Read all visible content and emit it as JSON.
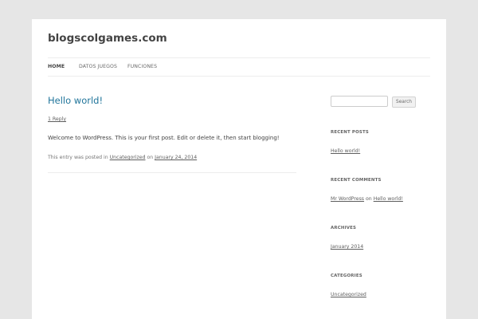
{
  "site": {
    "title": "blogscolgames.com"
  },
  "nav": {
    "items": [
      "Home",
      "Datos Juegos",
      "Funciones"
    ]
  },
  "post": {
    "title": "Hello world!",
    "reply_link": "1 Reply",
    "content": "Welcome to WordPress. This is your first post. Edit or delete it, then start blogging!",
    "meta_prefix": "This entry was posted in",
    "category": "Uncategorized",
    "meta_on": "on",
    "date": "January 24, 2014"
  },
  "sidebar": {
    "search_button": "Search",
    "recent_posts_title": "Recent Posts",
    "recent_posts": [
      "Hello world!"
    ],
    "recent_comments_title": "Recent Comments",
    "comment_author": "Mr WordPress",
    "comment_on": "on",
    "comment_post": "Hello world!",
    "archives_title": "Archives",
    "archives": [
      "January 2014"
    ],
    "categories_title": "Categories",
    "categories": [
      "Uncategorized"
    ]
  }
}
